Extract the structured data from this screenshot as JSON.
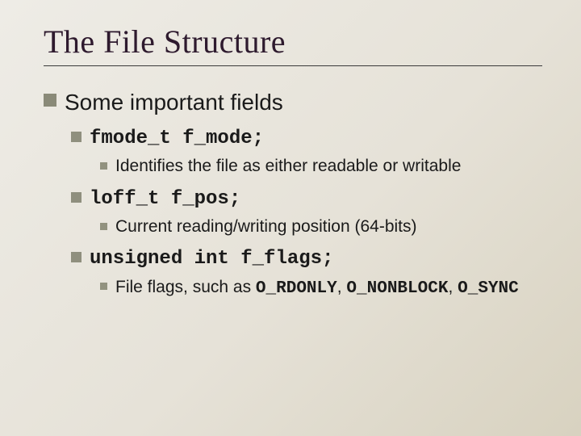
{
  "title": "The File Structure",
  "lvl1": "Some important fields",
  "items": [
    {
      "code": "fmode_t f_mode;",
      "desc_prefix": "Identifies the file as either readable or writable",
      "codes": []
    },
    {
      "code": "loff_t f_pos;",
      "desc_prefix": "Current reading/writing position (64-bits)",
      "codes": []
    },
    {
      "code": "unsigned int f_flags;",
      "desc_prefix": "File flags, such as ",
      "codes": [
        "O_RDONLY",
        "O_NONBLOCK",
        "O_SYNC"
      ]
    }
  ]
}
